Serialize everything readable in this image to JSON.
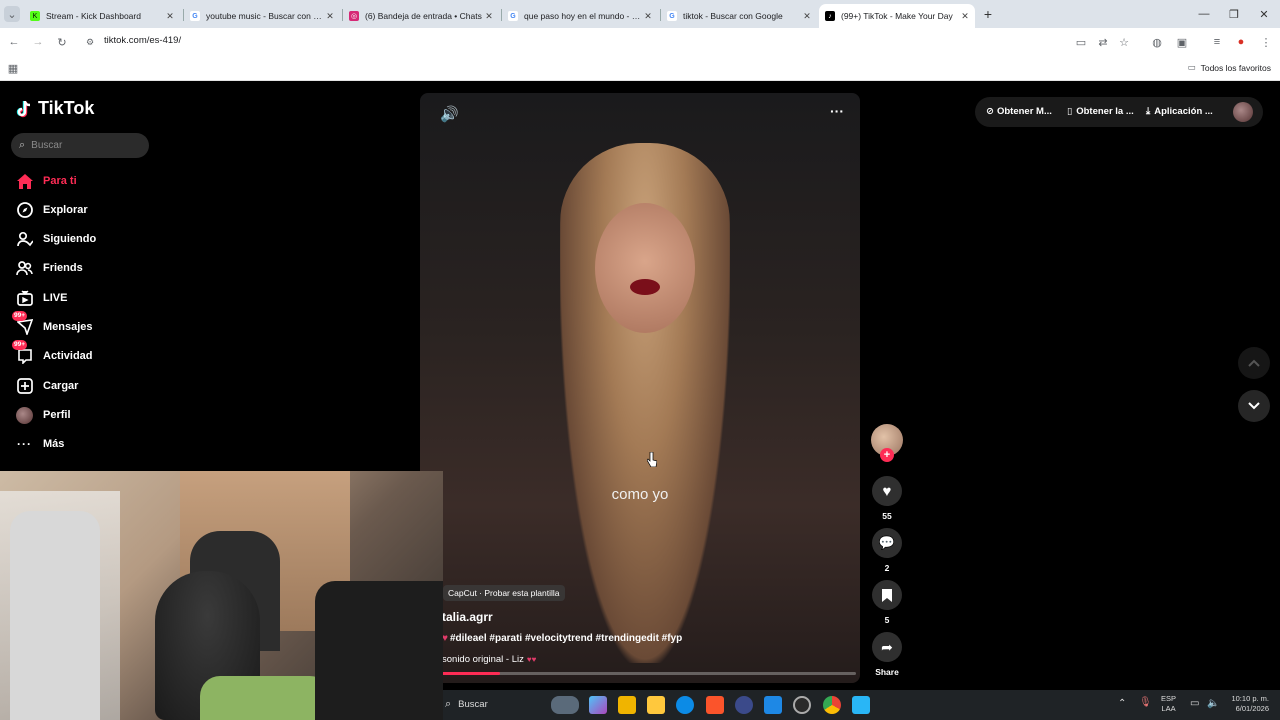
{
  "browser": {
    "tabs": [
      {
        "title": "Stream - Kick Dashboard",
        "favicon_color": "#53fc18",
        "favicon_text": "K"
      },
      {
        "title": "youtube music - Buscar con Goo",
        "favicon_color": "#4285f4",
        "favicon_text": "G"
      },
      {
        "title": "(6) Bandeja de entrada • Chats",
        "favicon_color": "#d62976",
        "favicon_text": "◎"
      },
      {
        "title": "que paso hoy en el mundo - Bu",
        "favicon_color": "#4285f4",
        "favicon_text": "G"
      },
      {
        "title": "tiktok - Buscar con Google",
        "favicon_color": "#4285f4",
        "favicon_text": "G"
      },
      {
        "title": "(99+) TikTok - Make Your Day",
        "favicon_color": "#000000",
        "favicon_text": "♪"
      }
    ],
    "new_tab": "+",
    "url": "tiktok.com/es-419/",
    "bookmarks_folder": "Todos los favoritos"
  },
  "tiktok": {
    "logo": "TikTok",
    "search_placeholder": "Buscar",
    "nav": [
      {
        "label": "Para ti",
        "icon": "home-icon",
        "active": true
      },
      {
        "label": "Explorar",
        "icon": "compass-icon"
      },
      {
        "label": "Siguiendo",
        "icon": "following-icon"
      },
      {
        "label": "Friends",
        "icon": "friends-icon"
      },
      {
        "label": "LIVE",
        "icon": "live-icon"
      },
      {
        "label": "Mensajes",
        "icon": "messages-icon",
        "badge": "99+"
      },
      {
        "label": "Actividad",
        "icon": "activity-icon",
        "badge": "99+"
      },
      {
        "label": "Cargar",
        "icon": "upload-icon"
      },
      {
        "label": "Perfil",
        "icon": "avatar"
      },
      {
        "label": "Más",
        "icon": "more-icon"
      }
    ],
    "header": {
      "coins": "Obtener M...",
      "app": "Obtener la ...",
      "download": "Aplicación ..."
    },
    "video": {
      "caption_overlay": "como yo",
      "template_tag": "CapCut · Probar esta plantilla",
      "author": "talia.agrr",
      "hashtags": "#dileael #parati #velocitytrend #trendingedit #fyp",
      "sound": "sonido original - Liz",
      "progress": 0.14
    },
    "actions": {
      "likes": "55",
      "comments": "2",
      "saves": "5",
      "share": "Share"
    }
  },
  "taskbar": {
    "search": "Buscar",
    "lang_line1": "ESP",
    "lang_line2": "LAA",
    "time": "10:10 p. m.",
    "date": "6/01/2026"
  },
  "colors": {
    "brand": "#fe2c55",
    "tab_strip": "#dde3ea"
  }
}
